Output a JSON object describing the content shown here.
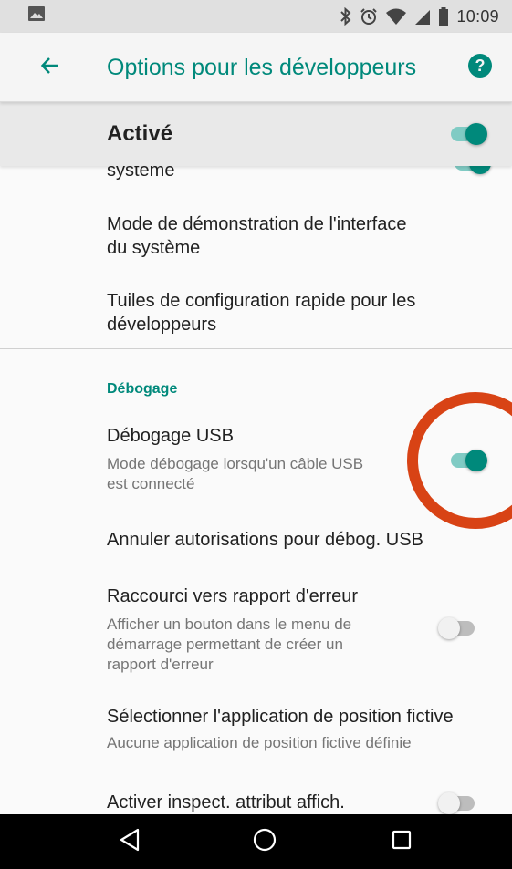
{
  "status_bar": {
    "time": "10:09",
    "icons": [
      "image-notification-icon",
      "bluetooth-icon",
      "alarm-icon",
      "wifi-icon",
      "signal-icon",
      "battery-icon"
    ]
  },
  "app_bar": {
    "title": "Options pour les développeurs",
    "back_icon": "arrow-back-icon",
    "help_icon": "help-icon"
  },
  "master_switch": {
    "label": "Activé",
    "on": true
  },
  "partial_item": {
    "title": "système"
  },
  "items_top": [
    {
      "title_line1": "Mode de démonstration de l'interface",
      "title_line2": "du système"
    },
    {
      "title_line1": "Tuiles de configuration rapide pour les",
      "title_line2": "développeurs"
    }
  ],
  "debug_section": {
    "header": "Débogage",
    "usb_debugging": {
      "title": "Débogage USB",
      "subtitle_line1": "Mode débogage lorsqu'un câble USB",
      "subtitle_line2": "est connecté",
      "on": true
    },
    "revoke_usb": {
      "title": "Annuler autorisations pour débog. USB"
    },
    "bug_report_shortcut": {
      "title": "Raccourci vers rapport d'erreur",
      "subtitle_line1": "Afficher un bouton dans le menu de",
      "subtitle_line2": "démarrage permettant de créer un",
      "subtitle_line3": "rapport d'erreur",
      "on": false
    },
    "mock_location": {
      "title": "Sélectionner l'application de position fictive",
      "subtitle": "Aucune application de position fictive définie"
    },
    "view_attribute_inspection": {
      "title": "Activer inspect. attribut affich.",
      "on": false
    }
  },
  "colors": {
    "accent": "#00897b",
    "highlight_ring": "#d84315"
  },
  "nav_bar": {
    "icons": [
      "back-triangle-icon",
      "home-circle-icon",
      "recents-square-icon"
    ]
  }
}
